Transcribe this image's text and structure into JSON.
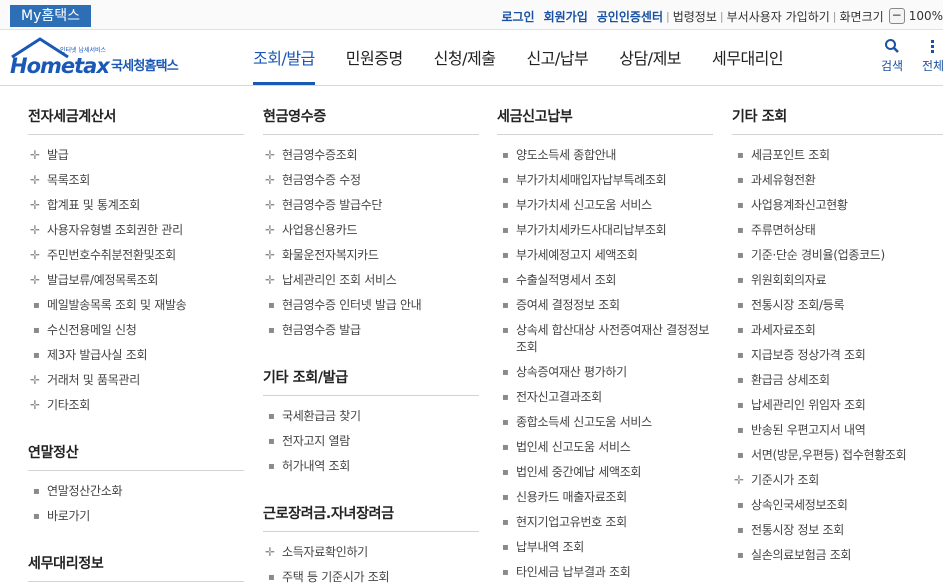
{
  "topbar": {
    "myhome": "My홈택스",
    "links": [
      {
        "label": "로그인",
        "style": "blue"
      },
      {
        "label": "회원가입",
        "style": "blue"
      },
      {
        "label": "공인인증센터",
        "style": "blue"
      },
      {
        "label": "법령정보",
        "style": "gray"
      },
      {
        "label": "부서사용자 가입하기",
        "style": "gray"
      },
      {
        "label": "화면크기",
        "style": "gray"
      }
    ],
    "zoom_minus": "−",
    "zoom_value": "100%"
  },
  "logo": {
    "small": "인터넷 납세서비스",
    "main": "Hometax",
    "sub": "국세청홈택스"
  },
  "gnb": [
    {
      "label": "조회/발급",
      "active": true
    },
    {
      "label": "민원증명",
      "active": false
    },
    {
      "label": "신청/제출",
      "active": false
    },
    {
      "label": "신고/납부",
      "active": false
    },
    {
      "label": "상담/제보",
      "active": false
    },
    {
      "label": "세무대리인",
      "active": false
    }
  ],
  "header_icons": {
    "search": "검색",
    "all": "전체"
  },
  "colors": {
    "brand": "#1a58b5",
    "myhome_bg": "#2c6fb7"
  },
  "menu": [
    {
      "sections": [
        {
          "title": "전자세금계산서",
          "items": [
            {
              "label": "발급",
              "marker": "plus"
            },
            {
              "label": "목록조회",
              "marker": "plus"
            },
            {
              "label": "합계표 및 통계조회",
              "marker": "plus"
            },
            {
              "label": "사용자유형별 조회권한 관리",
              "marker": "plus"
            },
            {
              "label": "주민번호수취분전환및조회",
              "marker": "plus"
            },
            {
              "label": "발급보류/예정목록조회",
              "marker": "plus"
            },
            {
              "label": "메일발송목록 조회 및 재발송",
              "marker": "dot"
            },
            {
              "label": "수신전용메일 신청",
              "marker": "dot"
            },
            {
              "label": "제3자 발급사실 조회",
              "marker": "dot"
            },
            {
              "label": "거래처 및 품목관리",
              "marker": "plus"
            },
            {
              "label": "기타조회",
              "marker": "plus"
            }
          ]
        },
        {
          "title": "연말정산",
          "items": [
            {
              "label": "연말정산간소화",
              "marker": "dot"
            },
            {
              "label": "바로가기",
              "marker": "dot"
            }
          ]
        },
        {
          "title": "세무대리정보",
          "items": []
        }
      ]
    },
    {
      "sections": [
        {
          "title": "현금영수증",
          "items": [
            {
              "label": "현금영수증조회",
              "marker": "plus"
            },
            {
              "label": "현금영수증 수정",
              "marker": "plus"
            },
            {
              "label": "현금영수증 발급수단",
              "marker": "plus"
            },
            {
              "label": "사업용신용카드",
              "marker": "plus"
            },
            {
              "label": "화물운전자복지카드",
              "marker": "plus"
            },
            {
              "label": "납세관리인 조회 서비스",
              "marker": "plus"
            },
            {
              "label": "현금영수증 인터넷 발급 안내",
              "marker": "dot"
            },
            {
              "label": "현금영수증 발급",
              "marker": "dot"
            }
          ]
        },
        {
          "title": "기타 조회/발급",
          "items": [
            {
              "label": "국세환급금 찾기",
              "marker": "dot"
            },
            {
              "label": "전자고지 열람",
              "marker": "dot"
            },
            {
              "label": "허가내역 조회",
              "marker": "dot"
            }
          ]
        },
        {
          "title": "근로장려금.자녀장려금",
          "items": [
            {
              "label": "소득자료확인하기",
              "marker": "plus"
            },
            {
              "label": "주택 등 기준시가 조회",
              "marker": "dot"
            }
          ]
        }
      ]
    },
    {
      "sections": [
        {
          "title": "세금신고납부",
          "items": [
            {
              "label": "양도소득세 종합안내",
              "marker": "dot"
            },
            {
              "label": "부가가치세매입자납부특례조회",
              "marker": "dot"
            },
            {
              "label": "부가가치세 신고도움 서비스",
              "marker": "dot"
            },
            {
              "label": "부가가치세카드사대리납부조회",
              "marker": "dot"
            },
            {
              "label": "부가세예정고지 세액조회",
              "marker": "dot"
            },
            {
              "label": "수출실적명세서 조회",
              "marker": "dot"
            },
            {
              "label": "증여세 결정정보 조회",
              "marker": "dot"
            },
            {
              "label": "상속세 합산대상 사전증여재산 결정정보 조회",
              "marker": "dot"
            },
            {
              "label": "상속증여재산 평가하기",
              "marker": "dot"
            },
            {
              "label": "전자신고결과조회",
              "marker": "dot"
            },
            {
              "label": "종합소득세 신고도움 서비스",
              "marker": "dot"
            },
            {
              "label": "법인세 신고도움 서비스",
              "marker": "dot"
            },
            {
              "label": "법인세 중간예납 세액조회",
              "marker": "dot"
            },
            {
              "label": "신용카드 매출자료조회",
              "marker": "dot"
            },
            {
              "label": "현지기업고유번호 조회",
              "marker": "dot"
            },
            {
              "label": "납부내역 조회",
              "marker": "dot"
            },
            {
              "label": "타인세금 납부결과 조회",
              "marker": "dot"
            }
          ]
        }
      ]
    },
    {
      "sections": [
        {
          "title": "기타 조회",
          "items": [
            {
              "label": "세금포인트 조회",
              "marker": "dot"
            },
            {
              "label": "과세유형전환",
              "marker": "dot"
            },
            {
              "label": "사업용계좌신고현황",
              "marker": "dot"
            },
            {
              "label": "주류면허상태",
              "marker": "dot"
            },
            {
              "label": "기준·단순 경비율(업종코드)",
              "marker": "dot"
            },
            {
              "label": "위원회회의자료",
              "marker": "dot"
            },
            {
              "label": "전통시장 조회/등록",
              "marker": "dot"
            },
            {
              "label": "과세자료조회",
              "marker": "dot"
            },
            {
              "label": "지급보증 정상가격 조회",
              "marker": "dot"
            },
            {
              "label": "환급금 상세조회",
              "marker": "dot"
            },
            {
              "label": "납세관리인 위임자 조회",
              "marker": "dot"
            },
            {
              "label": "반송된 우편고지서 내역",
              "marker": "dot"
            },
            {
              "label": "서면(방문,우편등) 접수현황조회",
              "marker": "dot"
            },
            {
              "label": "기준시가 조회",
              "marker": "plus"
            },
            {
              "label": "상속인국세정보조회",
              "marker": "dot"
            },
            {
              "label": "전통시장 정보 조회",
              "marker": "dot"
            },
            {
              "label": "실손의료보험금 조회",
              "marker": "dot"
            }
          ]
        }
      ]
    }
  ]
}
